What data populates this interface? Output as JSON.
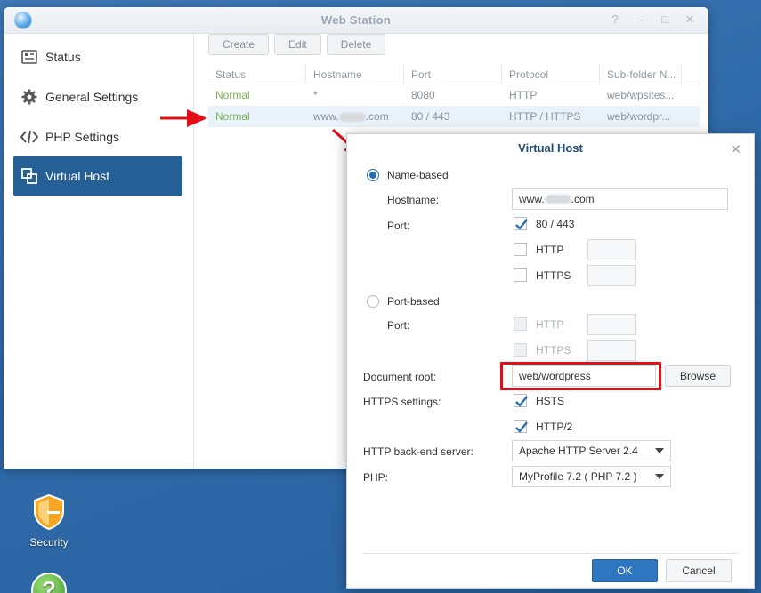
{
  "window": {
    "title": "Web Station",
    "controls": [
      "?",
      "–",
      "□",
      "✕"
    ]
  },
  "sidebar": {
    "items": [
      {
        "label": "Status",
        "icon": "status-icon"
      },
      {
        "label": "General Settings",
        "icon": "gear-icon"
      },
      {
        "label": "PHP Settings",
        "icon": "code-icon"
      },
      {
        "label": "Virtual Host",
        "icon": "virtual-host-icon",
        "active": true
      }
    ]
  },
  "toolbar": {
    "create": "Create",
    "edit": "Edit",
    "delete": "Delete"
  },
  "grid": {
    "columns": [
      "Status",
      "Hostname",
      "Port",
      "Protocol",
      "Sub-folder N..."
    ],
    "rows": [
      {
        "status": "Normal",
        "hostname": "*",
        "port": "8080",
        "protocol": "HTTP",
        "subfolder": "web/wpsites..."
      },
      {
        "status": "Normal",
        "hostname_prefix": "www.",
        "hostname_suffix": ".com",
        "port": "80 / 443",
        "protocol": "HTTP / HTTPS",
        "subfolder": "web/wordpr..."
      }
    ]
  },
  "dialog": {
    "title": "Virtual Host",
    "name_based": "Name-based",
    "hostname_label": "Hostname:",
    "hostname_prefix": "www.",
    "hostname_suffix": ".com",
    "port_label": "Port:",
    "port_80_443": "80 / 443",
    "http": "HTTP",
    "https": "HTTPS",
    "port_based": "Port-based",
    "port_label2": "Port:",
    "http2_label": "HTTP",
    "https2_label": "HTTPS",
    "document_root_label": "Document root:",
    "document_root_value": "web/wordpress",
    "browse": "Browse",
    "https_settings_label": "HTTPS settings:",
    "hsts": "HSTS",
    "http2": "HTTP/2",
    "backend_label": "HTTP back-end server:",
    "backend_value": "Apache HTTP Server 2.4",
    "php_label": "PHP:",
    "php_value": "MyProfile 7.2 ( PHP 7.2 )",
    "ok": "OK",
    "cancel": "Cancel"
  },
  "desktop": {
    "security_label": "Security"
  },
  "colors": {
    "accent": "#245f96",
    "status_normal": "#79b552",
    "highlight": "#e30e17",
    "desktop": "#2f6aa8"
  }
}
